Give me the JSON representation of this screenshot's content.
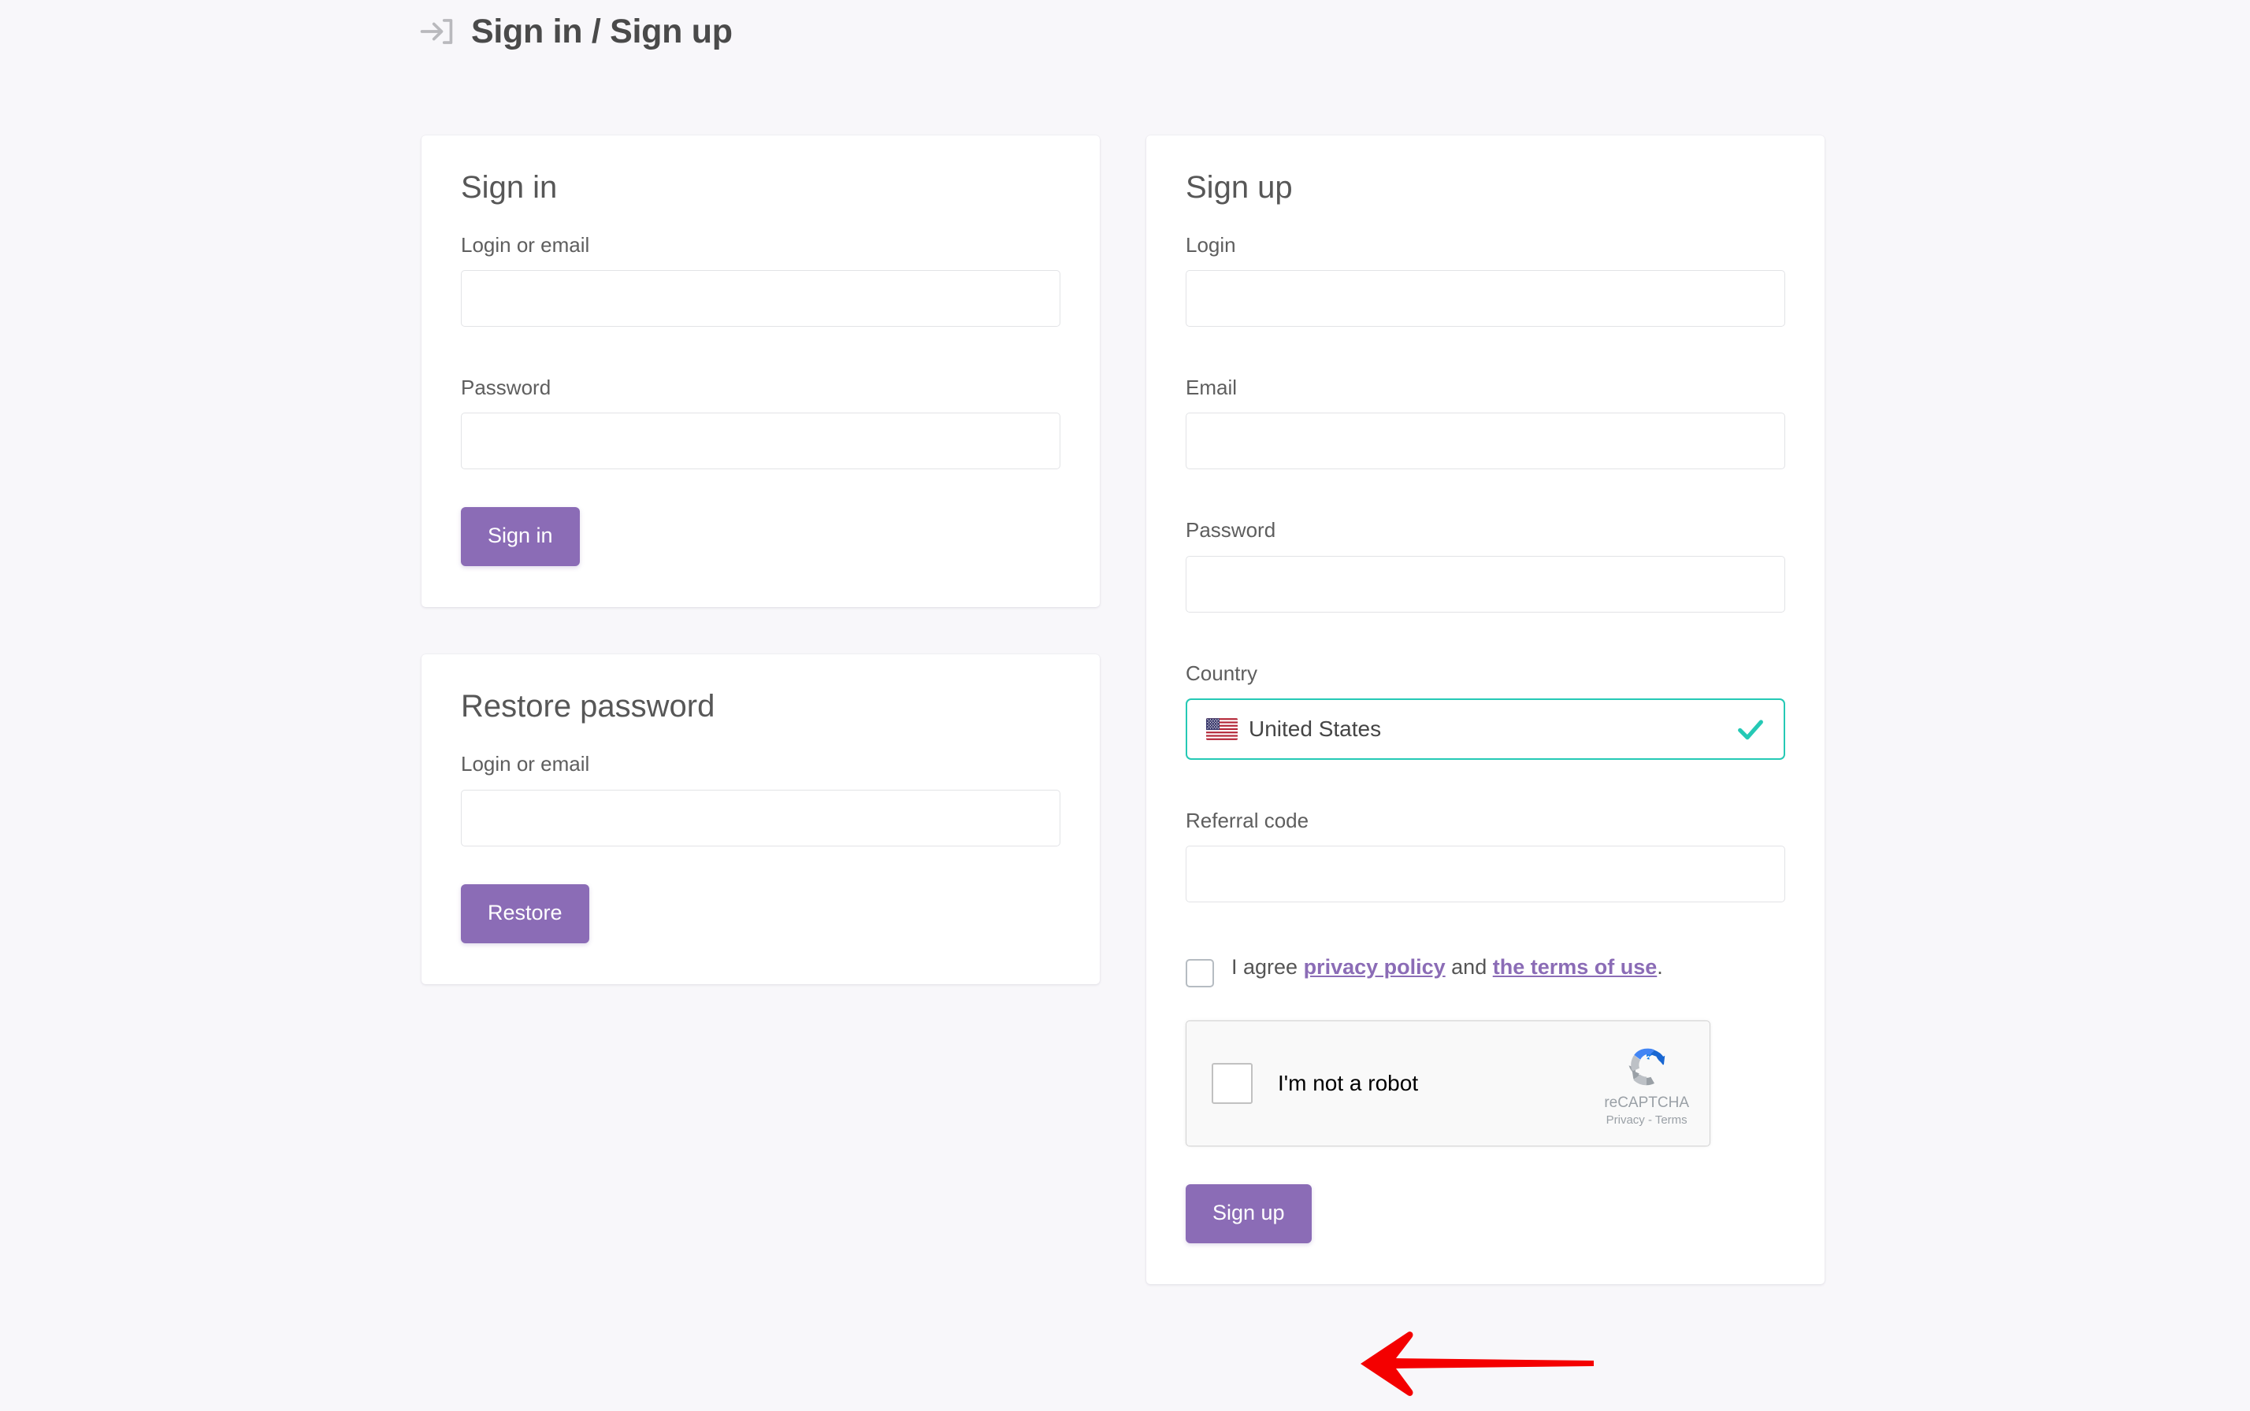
{
  "header": {
    "title": "Sign in / Sign up",
    "icon": "login-arrow-icon"
  },
  "signin_card": {
    "title": "Sign in",
    "login_label": "Login or email",
    "login_value": "",
    "login_placeholder": "",
    "password_label": "Password",
    "password_value": "",
    "password_placeholder": "",
    "submit_label": "Sign in"
  },
  "restore_card": {
    "title": "Restore password",
    "login_label": "Login or email",
    "login_value": "",
    "login_placeholder": "",
    "submit_label": "Restore"
  },
  "signup_card": {
    "title": "Sign up",
    "login_label": "Login",
    "login_value": "",
    "login_placeholder": "",
    "email_label": "Email",
    "email_value": "",
    "email_placeholder": "",
    "password_label": "Password",
    "password_value": "",
    "password_placeholder": "",
    "country_label": "Country",
    "country_value": "United States",
    "country_flag": "us-flag-icon",
    "country_valid_icon": "check-icon",
    "referral_label": "Referral code",
    "referral_value": "",
    "referral_placeholder": "",
    "agree": {
      "checked": false,
      "prefix": "I agree ",
      "privacy_link": "privacy policy",
      "middle": " and ",
      "terms_link": "the terms of use",
      "suffix": "."
    },
    "recaptcha": {
      "label": "I'm not a robot",
      "brand": "reCAPTCHA",
      "links": "Privacy - Terms",
      "checked": false
    },
    "submit_label": "Sign up"
  },
  "annotation": {
    "arrow": "red-left-arrow",
    "color": "#f40000"
  },
  "colors": {
    "page_background": "#f8f7fa",
    "card_background": "#ffffff",
    "primary_button": "#8b6cb6",
    "link": "#8b6cb6",
    "valid_border": "#25c9b5",
    "valid_check": "#25c9b5",
    "input_border": "#e2e3e6",
    "title_text": "#4a4a4a"
  }
}
